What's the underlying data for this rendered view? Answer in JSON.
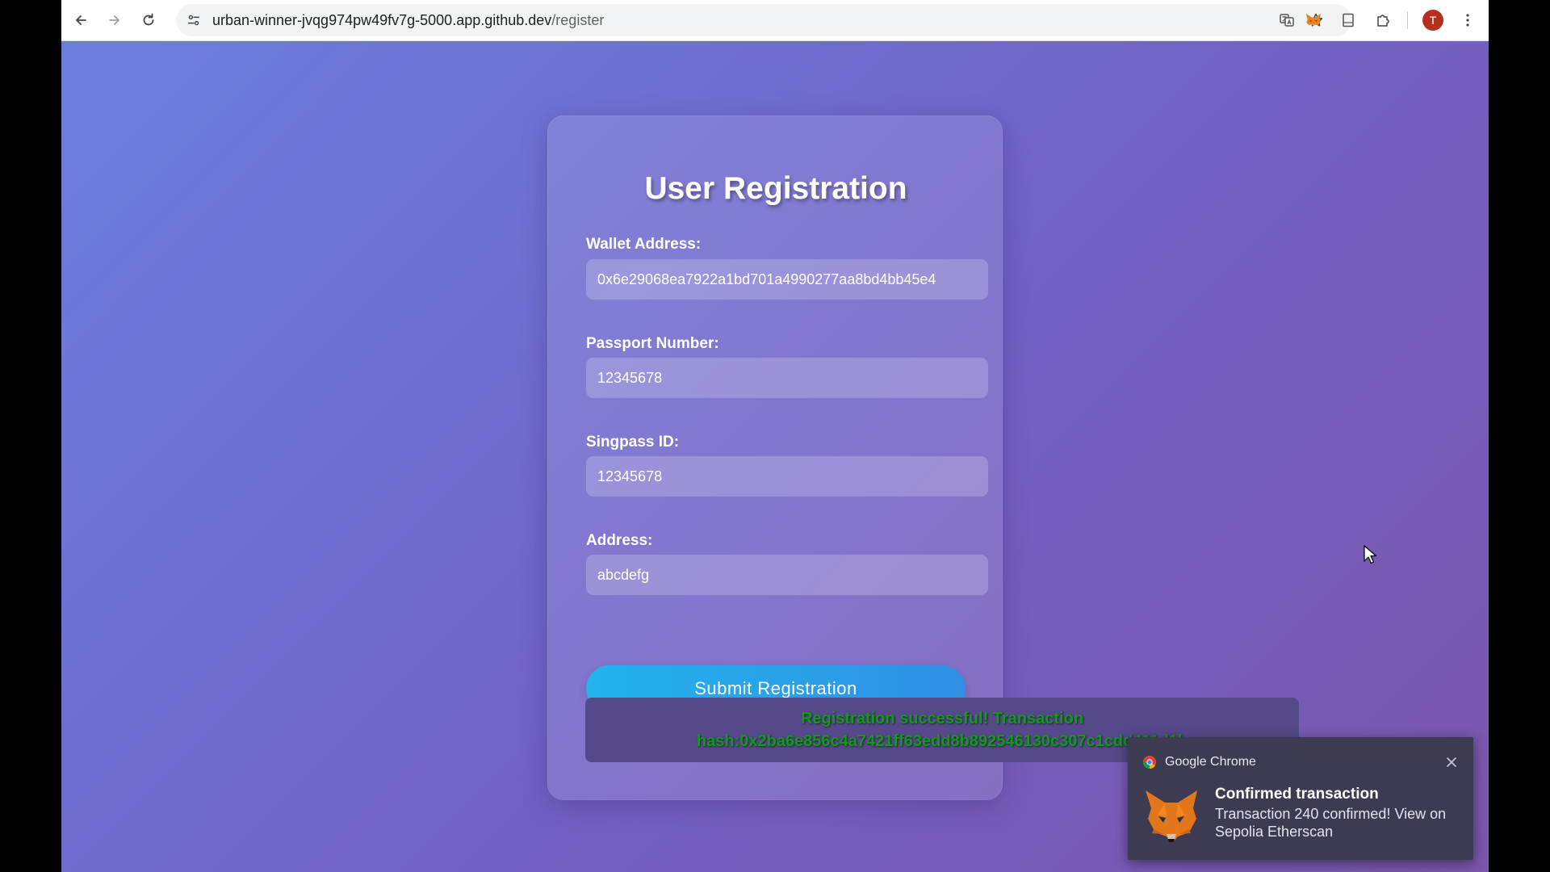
{
  "browser": {
    "url_host": "urban-winner-jvqg974pw49fv7g-5000.app.github.dev",
    "url_path": "/register",
    "profile_initial": "T",
    "icons": [
      "back-arrow-icon",
      "forward-arrow-icon",
      "reload-icon",
      "site-settings-icon",
      "translate-icon",
      "bookmark-star-icon",
      "metamask-extension-icon",
      "document-icon",
      "extensions-puzzle-icon",
      "kebab-menu-icon"
    ]
  },
  "form": {
    "title": "User Registration",
    "wallet_label": "Wallet Address:",
    "wallet_value": "0x6e29068ea7922a1bd701a4990277aa8bd4bb45e4",
    "passport_label": "Passport Number:",
    "passport_value": "12345678",
    "singpass_label": "Singpass ID:",
    "singpass_value": "12345678",
    "address_label": "Address:",
    "address_value": "abcdefg",
    "submit_label": "Submit Registration",
    "result_line1": "Registration successful! Transaction",
    "result_line2": "hash:0x2ba6e856c4a7421ff63edd8b892546130c307c1cdd411d1b",
    "result_color": "#119a1b"
  },
  "notification": {
    "app_name": "Google Chrome",
    "title": "Confirmed transaction",
    "body": "Transaction 240 confirmed! View on Sepolia Etherscan"
  },
  "colors": {
    "background_start": "#6b7fdf",
    "background_end": "#7a56ac",
    "button_start": "#23b4ec",
    "button_end": "#2f8fe6",
    "notification_bg": "#3c3b52"
  }
}
